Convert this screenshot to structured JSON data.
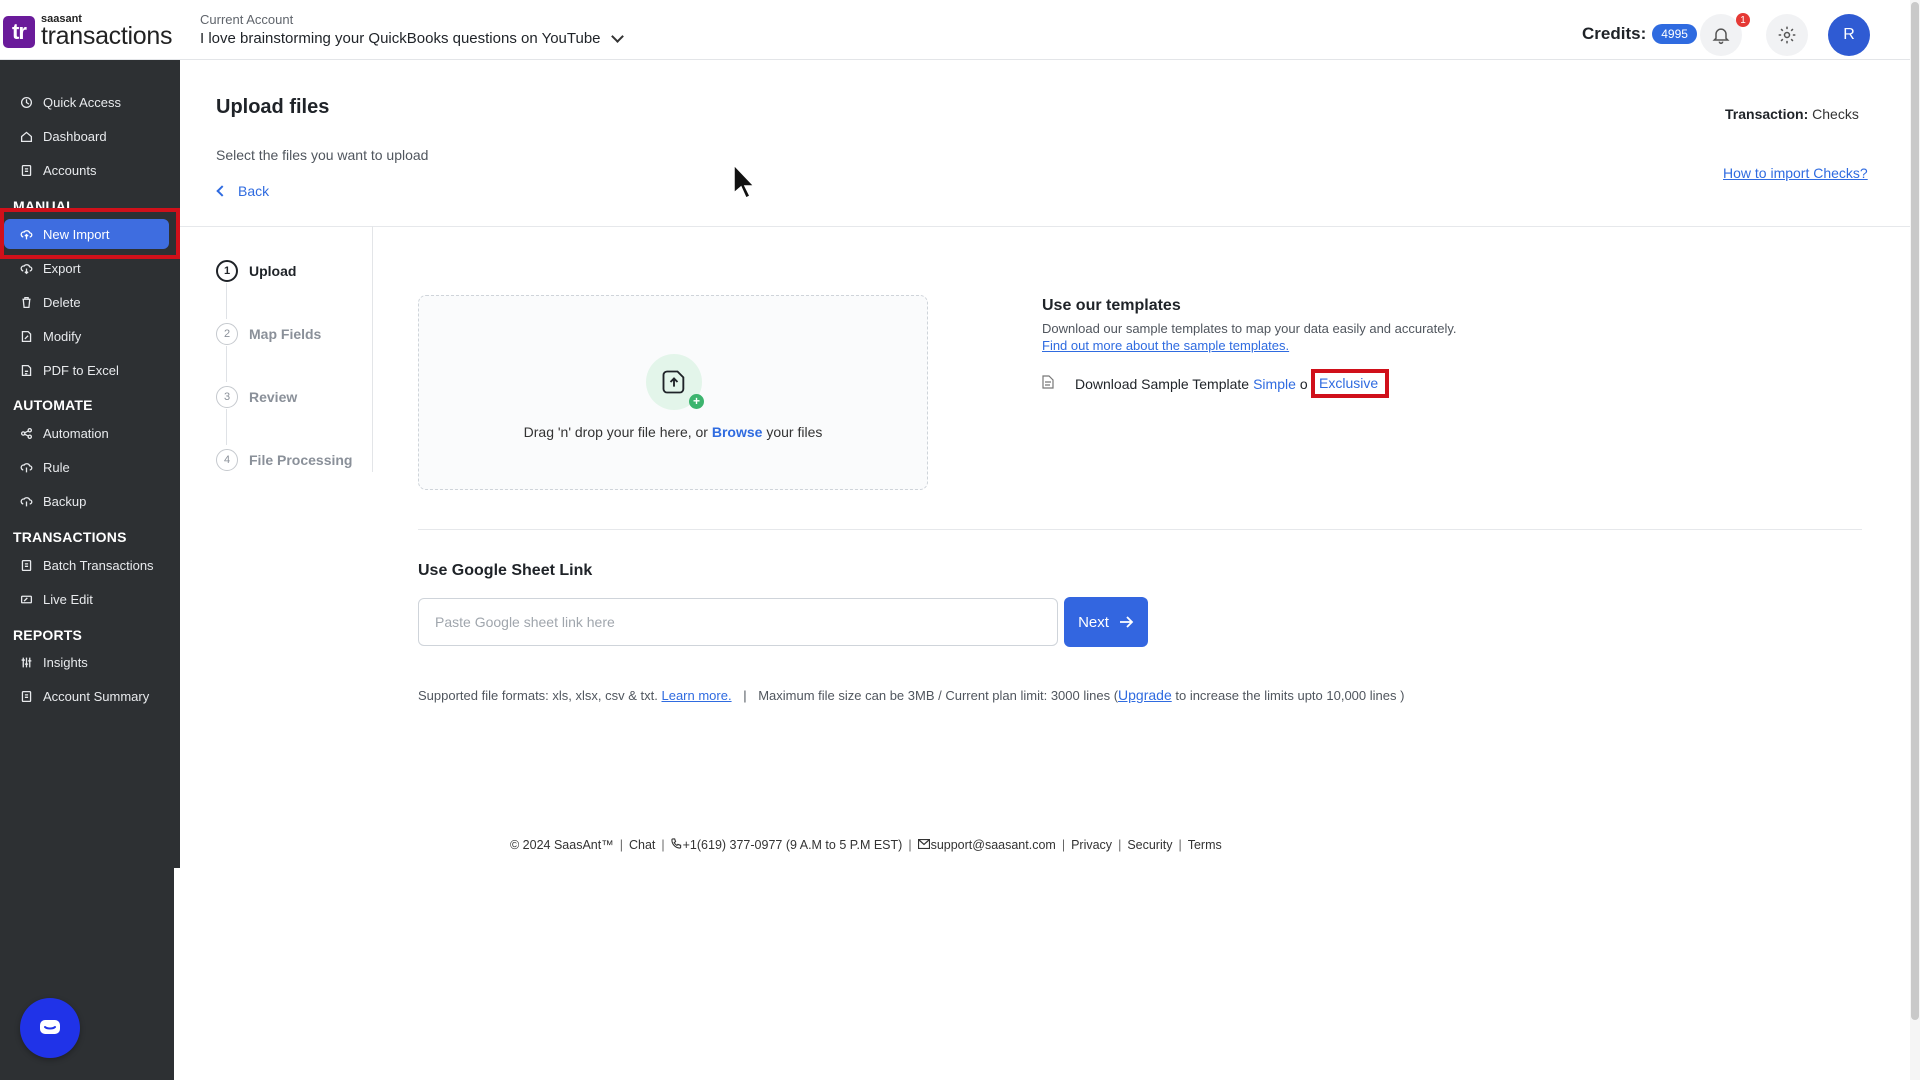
{
  "header": {
    "logo_small": "saasant",
    "logo_big": "transactions",
    "logo_mark": "tr",
    "account_label": "Current Account",
    "account_name": "I love brainstorming your QuickBooks questions on YouTube",
    "credits_label": "Credits:",
    "credits_value": "4995",
    "notification_count": "1",
    "avatar_initial": "R"
  },
  "sidebar": {
    "top_items": [
      {
        "label": "Quick Access",
        "icon": "quick-access-icon"
      },
      {
        "label": "Dashboard",
        "icon": "home-icon"
      },
      {
        "label": "Accounts",
        "icon": "clipboard-icon"
      }
    ],
    "sections": {
      "manual": "MANUAL",
      "automate": "AUTOMATE",
      "transactions": "TRANSACTIONS",
      "reports": "REPORTS"
    },
    "manual_items": [
      {
        "label": "New Import",
        "active": true
      },
      {
        "label": "Export"
      },
      {
        "label": "Delete"
      },
      {
        "label": "Modify"
      },
      {
        "label": "PDF to Excel"
      }
    ],
    "automate_items": [
      {
        "label": "Automation"
      },
      {
        "label": "Rule"
      },
      {
        "label": "Backup"
      }
    ],
    "transactions_items": [
      {
        "label": "Batch Transactions"
      },
      {
        "label": "Live Edit"
      }
    ],
    "reports_items": [
      {
        "label": "Insights"
      },
      {
        "label": "Account Summary"
      }
    ]
  },
  "main": {
    "title": "Upload files",
    "subtitle": "Select the files you want to upload",
    "back_label": "Back",
    "transaction_label": "Transaction:",
    "transaction_value": "Checks",
    "how_to_link": "How to import Checks?"
  },
  "steps": [
    {
      "num": "1",
      "label": "Upload",
      "active": true
    },
    {
      "num": "2",
      "label": "Map Fields"
    },
    {
      "num": "3",
      "label": "Review"
    },
    {
      "num": "4",
      "label": "File Processing"
    }
  ],
  "dropzone": {
    "text_before": "Drag 'n' drop your file here, or",
    "browse": "Browse",
    "text_after": "your files"
  },
  "templates": {
    "title": "Use our templates",
    "description": "Download our sample templates to map your data easily and accurately.",
    "find_out_link": "Find out more about the sample templates.",
    "download_label": "Download Sample Template",
    "simple": "Simple",
    "or": "o",
    "exclusive": "Exclusive"
  },
  "google_sheet": {
    "title": "Use Google Sheet Link",
    "placeholder": "Paste Google sheet link here",
    "next_label": "Next"
  },
  "formats": {
    "supported": "Supported file formats: xls, xlsx, csv & txt.",
    "learn_more": "Learn more.",
    "sep": "|",
    "limit_text": "Maximum file size can be 3MB / Current plan limit: 3000 lines (",
    "upgrade": "Upgrade",
    "limit_after": "to increase the limits upto 10,000 lines )"
  },
  "footer": {
    "copyright": "© 2024 SaasAnt™",
    "chat": "Chat",
    "phone": "+1(619) 377-0977 (9 A.M to 5 P.M EST)",
    "email": "support@saasant.com",
    "privacy": "Privacy",
    "security": "Security",
    "terms": "Terms",
    "sep": "|"
  },
  "colors": {
    "accent": "#3e6de0",
    "sidebar_bg": "#2d3033",
    "highlight": "#d0101a",
    "logo_purple": "#6a1b9a"
  }
}
